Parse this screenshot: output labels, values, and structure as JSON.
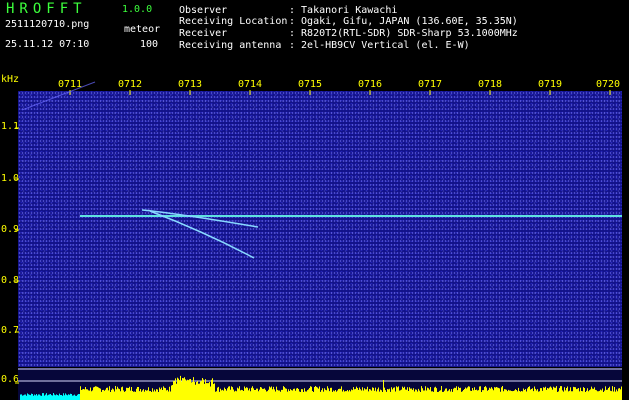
{
  "header": {
    "app_name": "HROFFT",
    "version": "1.0.0",
    "file_name": "2511120710.png",
    "detection_label": "meteor",
    "timestamp": "25.11.12 07:10",
    "detection_value": "100"
  },
  "info": {
    "observer_label": "Observer",
    "observer_value": ": Takanori Kawachi",
    "location_label": "Receiving Location",
    "location_value": ": Ogaki, Gifu, JAPAN (136.60E, 35.35N)",
    "receiver_label": "Receiver",
    "receiver_value": ": R820T2(RTL-SDR) SDR-Sharp 53.1000MHz",
    "antenna_label": "Receiving antenna",
    "antenna_value": ": 2el-HB9CV Vertical (el. E-W)"
  },
  "axis": {
    "unit": "kHz",
    "y_ticks": [
      "1.1",
      "1.0",
      "0.9",
      "0.8",
      "0.7",
      "0.6"
    ],
    "x_ticks": [
      "0711",
      "0712",
      "0713",
      "0714",
      "0715",
      "0716",
      "0717",
      "0718",
      "0719",
      "0720"
    ]
  },
  "colors": {
    "background": "#000000",
    "spectrogram": "#12128a",
    "signal": "#5fe0e0",
    "meteor": "#88d8ff",
    "logo": "#3cff3c",
    "axis_text": "#ffff00",
    "bars": "#ffff00",
    "bars_left": "#00ffff"
  }
}
